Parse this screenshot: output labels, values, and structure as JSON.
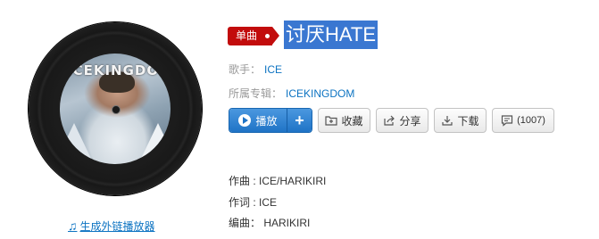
{
  "cover": {
    "artwork_text": "ICEKINGDOM"
  },
  "player_link": {
    "label": "生成外链播放器",
    "icon": "music-note-icon"
  },
  "song": {
    "badge": "单曲",
    "title": "讨厌HATE",
    "singer_label": "歌手：",
    "singer": "ICE",
    "album_label": "所属专辑：",
    "album": "ICEKINGDOM"
  },
  "actions": {
    "play": "播放",
    "add": "+",
    "collect": "收藏",
    "share": "分享",
    "download": "下载",
    "comment_count": "(1007)"
  },
  "credits": {
    "composer": "作曲 : ICE/HARIKIRI",
    "lyricist": "作词 : ICE",
    "arranger": "编曲： HARIKIRI"
  },
  "colors": {
    "accent_blue": "#0c73c2",
    "badge_red": "#c20c0c",
    "title_highlight": "#3a77d1",
    "play_button": "#1f73c6"
  }
}
